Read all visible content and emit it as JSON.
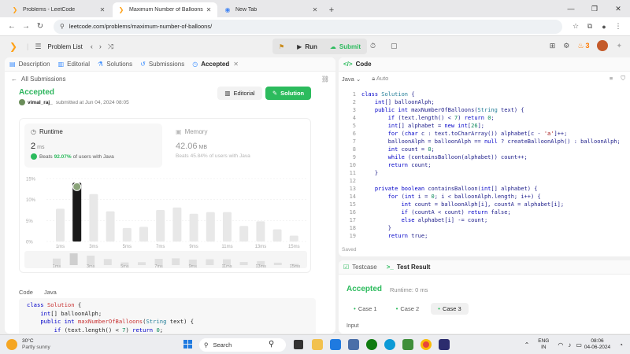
{
  "browser": {
    "tabs": [
      {
        "title": "Problems - LeetCode",
        "active": false
      },
      {
        "title": "Maximum Number of Balloons",
        "active": true
      },
      {
        "title": "New Tab",
        "active": false
      }
    ],
    "url": "leetcode.com/problems/maximum-number-of-balloons/"
  },
  "header": {
    "problem_list": "Problem List",
    "run": "Run",
    "submit": "Submit",
    "streak": "3"
  },
  "left_tabs": [
    {
      "label": "Description",
      "icon": "doc-icon",
      "active": false
    },
    {
      "label": "Editorial",
      "icon": "book-icon",
      "active": false
    },
    {
      "label": "Solutions",
      "icon": "flask-icon",
      "active": false
    },
    {
      "label": "Submissions",
      "icon": "history-icon",
      "active": false
    },
    {
      "label": "Accepted",
      "icon": "clock-icon",
      "active": true
    }
  ],
  "submission": {
    "back_label": "All Submissions",
    "status": "Accepted",
    "user": "vimal_raj_",
    "submitted_text": "submitted at Jun 04, 2024 08:05",
    "editorial_btn": "Editorial",
    "solution_btn": "Solution",
    "runtime": {
      "title": "Runtime",
      "value": "2",
      "unit": "ms",
      "beats_prefix": "Beats",
      "beats_pct": "92.07%",
      "beats_suffix": "of users with Java"
    },
    "memory": {
      "title": "Memory",
      "value": "42.06",
      "unit": "MB",
      "beats_prefix": "Beats",
      "beats_pct": "45.84%",
      "beats_suffix": "of users with Java"
    }
  },
  "chart_data": {
    "type": "bar",
    "ylim": [
      0,
      15
    ],
    "yticks": [
      "15%",
      "10%",
      "5%",
      "0%"
    ],
    "xticks": [
      "1ms",
      "3ms",
      "5ms",
      "7ms",
      "9ms",
      "11ms",
      "13ms",
      "15ms"
    ],
    "values": [
      7.8,
      14,
      11.3,
      7.2,
      3.2,
      3.5,
      7.5,
      8.1,
      6.6,
      7.0,
      7.0,
      3.7,
      4.8,
      2.9,
      1.4
    ],
    "highlight_index": 1,
    "colors": {
      "bar": "#e8e8e8",
      "highlight": "#1a1a1a"
    },
    "mini_xticks": [
      "1ms",
      "3ms",
      "5ms",
      "7ms",
      "9ms",
      "11ms",
      "13ms",
      "15ms"
    ]
  },
  "code_section": {
    "tab_code": "Code",
    "tab_lang": "Java",
    "preview_lines": [
      "class Solution {",
      "    int[] balloonAlph;",
      "    public int maxNumberOfBalloons(String text) {",
      "        if (text.length() < 7) return 0;"
    ]
  },
  "editor": {
    "title": "Code",
    "lang": "Java",
    "mode": "Auto",
    "lines": [
      "class Solution {",
      "    int[] balloonAlph;",
      "    public int maxNumberOfBalloons(String text) {",
      "        if (text.length() < 7) return 0;",
      "        int[] alphabet = new int[26];",
      "        for (char c : text.toCharArray()) alphabet[c - 'a']++;",
      "        balloonAlph = balloonAlph == null ? createBalloonAlph() : balloonAlph;",
      "        int count = 0;",
      "        while (containsBalloon(alphabet)) count++;",
      "        return count;",
      "    }",
      "",
      "    private boolean containsBalloon(int[] alphabet) {",
      "        for (int i = 0; i < balloonAlph.length; i++) {",
      "            int count = balloonAlph[i], countA = alphabet[i];",
      "            if (countA < count) return false;",
      "            else alphabet[i] -= count;",
      "        }",
      "        return true;"
    ],
    "saved": "Saved"
  },
  "testpanel": {
    "testcase_tab": "Testcase",
    "result_tab": "Test Result",
    "status": "Accepted",
    "runtime": "Runtime: 0 ms",
    "cases": [
      {
        "label": "Case 1",
        "active": false
      },
      {
        "label": "Case 2",
        "active": false
      },
      {
        "label": "Case 3",
        "active": true
      }
    ],
    "input_label": "Input"
  },
  "taskbar": {
    "weather_temp": "30°C",
    "weather_desc": "Partly sunny",
    "search": "Search",
    "lang_top": "ENG",
    "lang_bottom": "IN",
    "time": "08:06",
    "date": "04-06-2024"
  }
}
